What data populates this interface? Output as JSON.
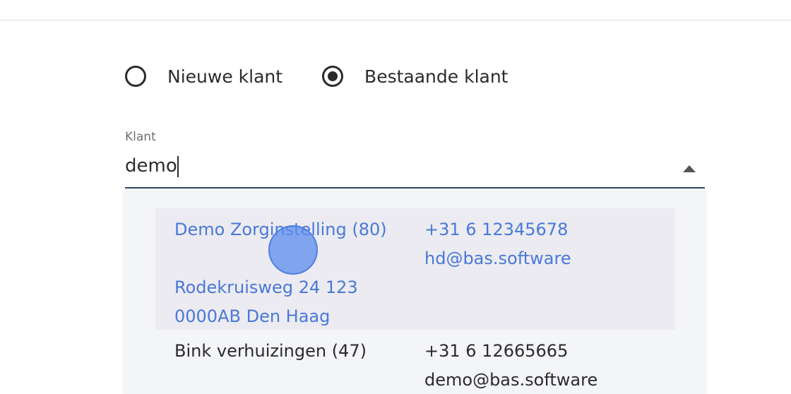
{
  "customer_type": {
    "options": [
      {
        "label": "Nieuwe klant",
        "selected": false
      },
      {
        "label": "Bestaande klant",
        "selected": true
      }
    ]
  },
  "customer_field": {
    "label": "Klant",
    "value": "demo"
  },
  "results": [
    {
      "name": "Demo Zorginstelling (80)",
      "address_line1": "Rodekruisweg 24 123",
      "address_line2": "0000AB Den Haag",
      "phone": "+31 6 12345678",
      "email": "hd@bas.software"
    },
    {
      "name": "Bink verhuizingen (47)",
      "phone": "+31 6 12665665",
      "email": "demo@bas.software"
    }
  ],
  "colors": {
    "highlight_text": "#4a78d8",
    "highlight_bg": "#ebebf1",
    "panel_bg": "#f4f5f9",
    "underline": "#2e4a66"
  }
}
